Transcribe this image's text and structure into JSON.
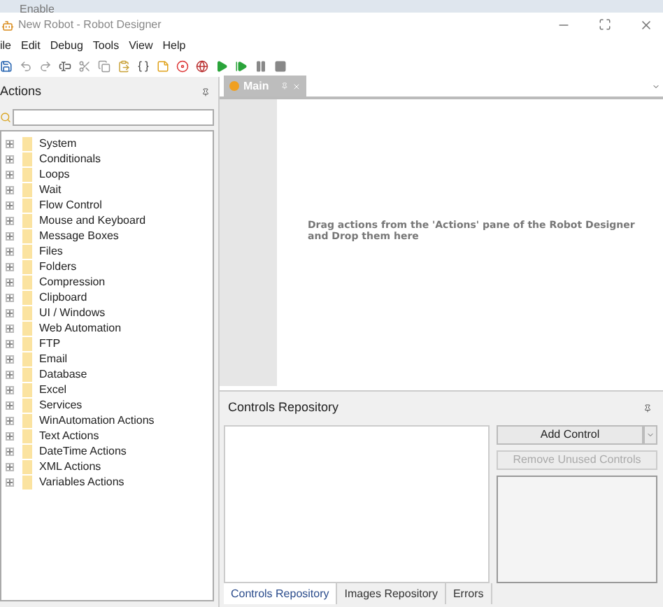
{
  "background_window": {
    "label": "Enable"
  },
  "window": {
    "title": "New Robot - Robot Designer"
  },
  "menu": [
    "ile",
    "Edit",
    "Debug",
    "Tools",
    "View",
    "Help"
  ],
  "actions_pane": {
    "title": "Actions",
    "tree": [
      {
        "label": "System",
        "expanded": false
      },
      {
        "label": "Conditionals",
        "expanded": false
      },
      {
        "label": "Loops",
        "expanded": false
      },
      {
        "label": "Wait",
        "expanded": false
      },
      {
        "label": "Flow Control",
        "expanded": false
      },
      {
        "label": "Mouse and Keyboard",
        "expanded": false
      },
      {
        "label": "Message Boxes",
        "expanded": false
      },
      {
        "label": "Files",
        "expanded": false
      },
      {
        "label": "Folders",
        "expanded": false
      },
      {
        "label": "Compression",
        "expanded": false
      },
      {
        "label": "Clipboard",
        "expanded": false
      },
      {
        "label": "UI / Windows",
        "expanded": false
      },
      {
        "label": "Web Automation",
        "expanded": false
      },
      {
        "label": "FTP",
        "expanded": false
      },
      {
        "label": "Email",
        "expanded": false
      },
      {
        "label": "Database",
        "expanded": false
      },
      {
        "label": "Excel",
        "expanded": false
      },
      {
        "label": "Services",
        "expanded": false
      },
      {
        "label": "WinAutomation Actions",
        "expanded": false
      },
      {
        "label": "Text Actions",
        "expanded": false
      },
      {
        "label": "DateTime Actions",
        "expanded": false
      },
      {
        "label": "XML Actions",
        "expanded": false
      },
      {
        "label": "Variables Actions",
        "expanded": false
      }
    ]
  },
  "editor": {
    "tabs": [
      {
        "label": "Main",
        "selected": true
      }
    ],
    "hint": "Drag actions from the 'Actions' pane of the Robot Designer and Drop them here"
  },
  "controls_repository": {
    "title": "Controls Repository",
    "buttons": [
      {
        "label": "Add Control",
        "disabled": false,
        "kind": "split"
      },
      {
        "label": "Remove Unused Controls",
        "disabled": true,
        "kind": "plain"
      }
    ],
    "tabs": [
      {
        "label": "Controls Repository",
        "selected": true
      },
      {
        "label": "Images Repository",
        "selected": false
      },
      {
        "label": "Errors",
        "selected": false
      }
    ]
  }
}
